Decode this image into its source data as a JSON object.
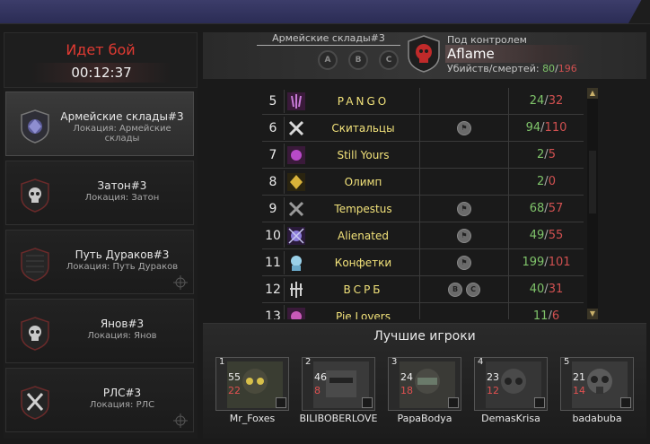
{
  "status": {
    "title": "Идет бой",
    "timer": "00:12:37"
  },
  "locations": [
    {
      "name": "Армейские склады#3",
      "sub": "Локация: Армейские склады",
      "icon": "shield-emblem-icon"
    },
    {
      "name": "Затон#3",
      "sub": "Локация: Затон",
      "icon": "skull-shield-icon"
    },
    {
      "name": "Путь Дураков#3",
      "sub": "Локация: Путь Дураков",
      "icon": "empty-shield-icon"
    },
    {
      "name": "Янов#3",
      "sub": "Локация: Янов",
      "icon": "skull-shield-icon"
    },
    {
      "name": "РЛС#3",
      "sub": "Локация: РЛС",
      "icon": "crossed-knives-icon"
    }
  ],
  "header": {
    "location": "Армейские склады#3",
    "points": [
      "A",
      "B",
      "C"
    ],
    "control_label": "Под контролем",
    "controller": "Aflame",
    "kd_label": "Убийств/смертей:",
    "kills": "80",
    "deaths": "196"
  },
  "clans": [
    {
      "rank": "5",
      "name": "PANGO",
      "flags": [],
      "kills": "24",
      "deaths": "32"
    },
    {
      "rank": "6",
      "name": "Скитальцы",
      "flags": [
        "flag"
      ],
      "kills": "94",
      "deaths": "110"
    },
    {
      "rank": "7",
      "name": "Still Yours",
      "flags": [],
      "kills": "2",
      "deaths": "5"
    },
    {
      "rank": "8",
      "name": "Олимп",
      "flags": [],
      "kills": "2",
      "deaths": "0"
    },
    {
      "rank": "9",
      "name": "Tempestus",
      "flags": [
        "flag"
      ],
      "kills": "68",
      "deaths": "57"
    },
    {
      "rank": "10",
      "name": "Alienated",
      "flags": [
        "flag"
      ],
      "kills": "49",
      "deaths": "55"
    },
    {
      "rank": "11",
      "name": "Конфетки",
      "flags": [
        "flag"
      ],
      "kills": "199",
      "deaths": "101"
    },
    {
      "rank": "12",
      "name": "ВСРБ",
      "flags": [
        "B",
        "C"
      ],
      "kills": "40",
      "deaths": "31"
    },
    {
      "rank": "13",
      "name": "Pie Lovers",
      "flags": [],
      "kills": "11",
      "deaths": "6"
    }
  ],
  "best_title": "Лучшие игроки",
  "players": [
    {
      "rank": "1",
      "kills": "55",
      "deaths": "22",
      "name": "Mr_Foxes"
    },
    {
      "rank": "2",
      "kills": "46",
      "deaths": "8",
      "name": "BILIBOBERLOVE"
    },
    {
      "rank": "3",
      "kills": "24",
      "deaths": "18",
      "name": "PapaBodya"
    },
    {
      "rank": "4",
      "kills": "23",
      "deaths": "12",
      "name": "DemasKrisa"
    },
    {
      "rank": "5",
      "kills": "21",
      "deaths": "14",
      "name": "badabuba"
    }
  ],
  "colors": {
    "accent_red": "#e03a32",
    "kill_green": "#7fc36a",
    "death_red": "#d05050",
    "clan_yellow": "#f2e27a"
  }
}
